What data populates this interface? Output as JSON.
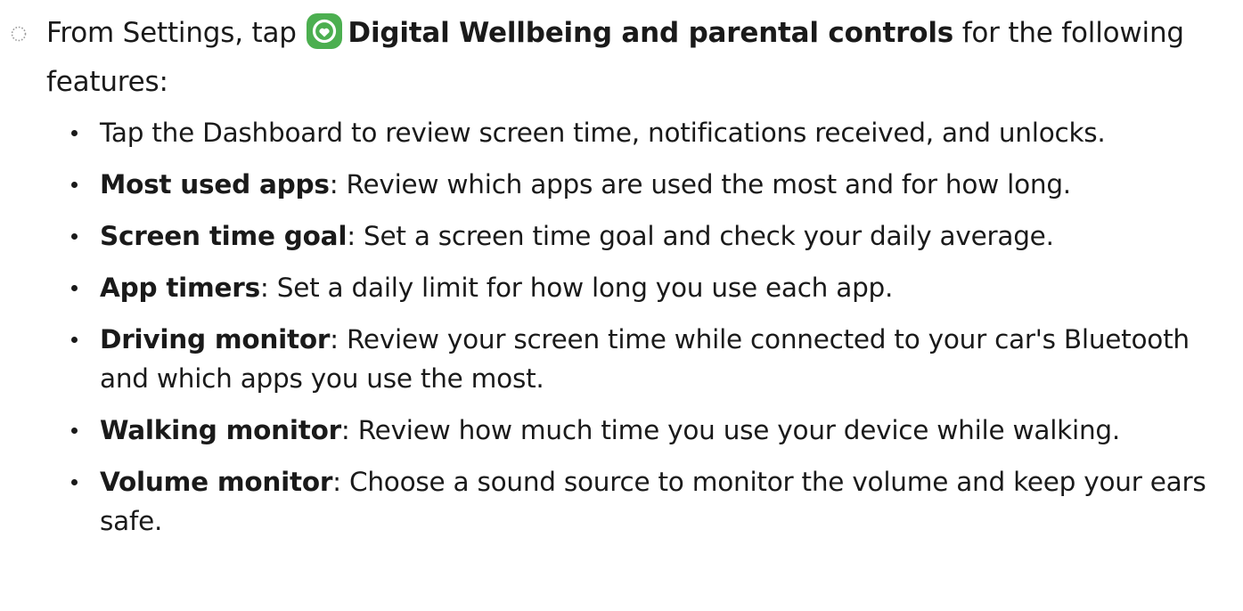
{
  "intro": {
    "lead": "From Settings, tap ",
    "icon": "digital-wellbeing-icon",
    "icon_color": "#4caf50",
    "link": "Digital Wellbeing and parental controls",
    "tail": " for the following features:"
  },
  "bullets": [
    {
      "term": "",
      "sep": "",
      "text": "Tap the Dashboard to review screen time, notifications received, and unlocks."
    },
    {
      "term": "Most used apps",
      "sep": ":",
      "text": " Review which apps are used the most and for how long."
    },
    {
      "term": "Screen time goal",
      "sep": ":",
      "text": " Set a screen time goal and check your daily average."
    },
    {
      "term": "App timers",
      "sep": ":",
      "text": " Set a daily limit for how long you use each app."
    },
    {
      "term": "Driving monitor",
      "sep": ":",
      "text": " Review your screen time while connected to your car's Bluetooth and which apps you use the most."
    },
    {
      "term": "Walking monitor",
      "sep": ":",
      "text": " Review how much time you use your device while walking."
    },
    {
      "term": "Volume monitor",
      "sep": ":",
      "text": " Choose a sound source to monitor the volume and keep your ears safe."
    }
  ]
}
